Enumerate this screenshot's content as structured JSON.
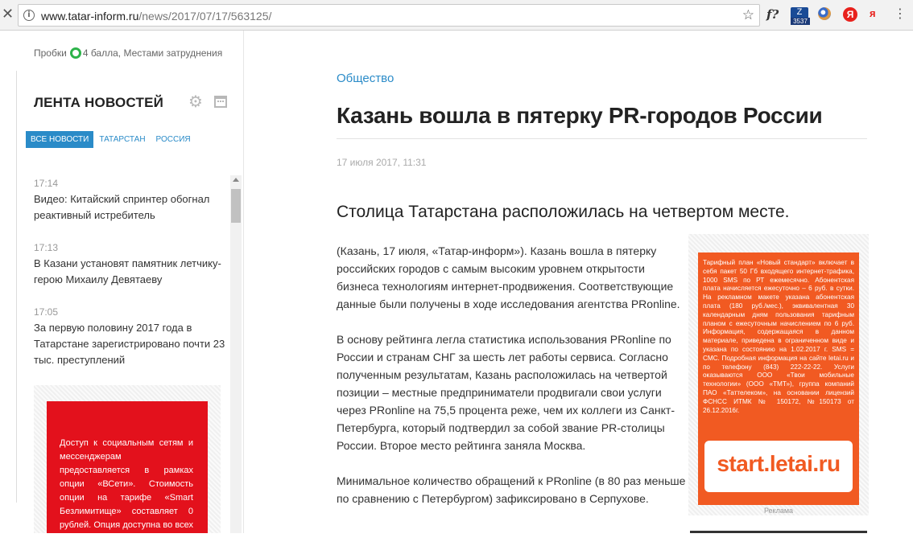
{
  "browser": {
    "url_host": "www.tatar-inform.ru",
    "url_path": "/news/2017/07/17/563125/",
    "counter_ext_value": "3537",
    "f_ext_label": "f?",
    "yandex_label": "Я",
    "yandex2_label": "я"
  },
  "sidebar": {
    "traffic_label": "Пробки",
    "traffic_status": "4 балла, Местами затруднения",
    "feed_title": "ЛЕНТА НОВОСТЕЙ",
    "tabs": [
      {
        "label": "ВСЕ НОВОСТИ"
      },
      {
        "label": "ТАТАРСТАН"
      },
      {
        "label": "РОССИЯ"
      }
    ],
    "news": [
      {
        "time": "17:14",
        "text": "Видео: Китайский спринтер обогнал реактивный истребитель"
      },
      {
        "time": "17:13",
        "text": "В Казани установят памятник летчику-герою Михаилу Девятаеву"
      },
      {
        "time": "17:05",
        "text": "За первую половину 2017 года в Татарстане зарегистрировано почти 23 тыс. преступлений"
      }
    ],
    "ad_text": "Доступ к социальным сетям и мессенджерам предоставляется в рамках опции «ВСети». Стоимость опции на тарифе «Smart Безлимитище» составляет 0 рублей. Опция доступна во всех регионах, кроме Норильска"
  },
  "article": {
    "category": "Общество",
    "title": "Казань вошла в пятерку PR-городов России",
    "date": "17 июля 2017, 11:31",
    "lead": "Столица Татарстана расположилась на четвертом месте.",
    "paragraphs": [
      "(Казань, 17 июля, «Татар-информ»). Казань вошла в пятерку российских городов с самым высоким уровнем открытости бизнеса технологиям интернет-продвижения. Соответствующие данные были получены в ходе исследования агентства PRonline.",
      "В основу рейтинга легла статистика использования PRonline по России и странам СНГ за шесть лет работы сервиса. Согласно полученным результатам, Казань расположилась на четвертой позиции – местные предприниматели продвигали свои услуги через PRonline на 75,5 процента реже, чем их коллеги из Санкт-Петербурга, который подтвердил за собой звание PR-столицы России. Второе место рейтинга заняла Москва.",
      "Минимальное количество обращений к PRonline (в 80 раз меньше по сравнению с Петербургом) зафиксировано в Серпухове."
    ]
  },
  "ad": {
    "small_text": "Тарифный план «Новый стандарт» включает в себя пакет 50 Гб входящего интернет-трафика, 1000 SMS по РТ ежемесячно. Абонентская плата начисляется ежесуточно – 6 руб. в сутки. На рекламном макете указана абонентская плата (180 руб./мес.), эквивалентная 30 календарным дням пользования тарифным планом с ежесуточным начислением по 6 руб. Информация, содержащаяся в данном материале, приведена в ограниченном виде и указана по состоянию на 1.02.2017 г. SMS = СМС. Подробная информация на сайте letai.ru и по телефону (843) 222-22-22. Услуги оказываются ООО «Твои мобильные технологии» (ООО «ТМТ»), группа компаний ПАО «Таттелеком», на основании лицензий ФСНСС ИТМК № 150172, №150173 от 26.12.2016г.",
    "logo": "start.letai.ru",
    "label": "Реклама"
  },
  "colors": {
    "accent": "#2a8bc8",
    "traffic_ok": "#2db34a",
    "ad_red": "#e3111c",
    "ad_orange": "#f15a22"
  }
}
